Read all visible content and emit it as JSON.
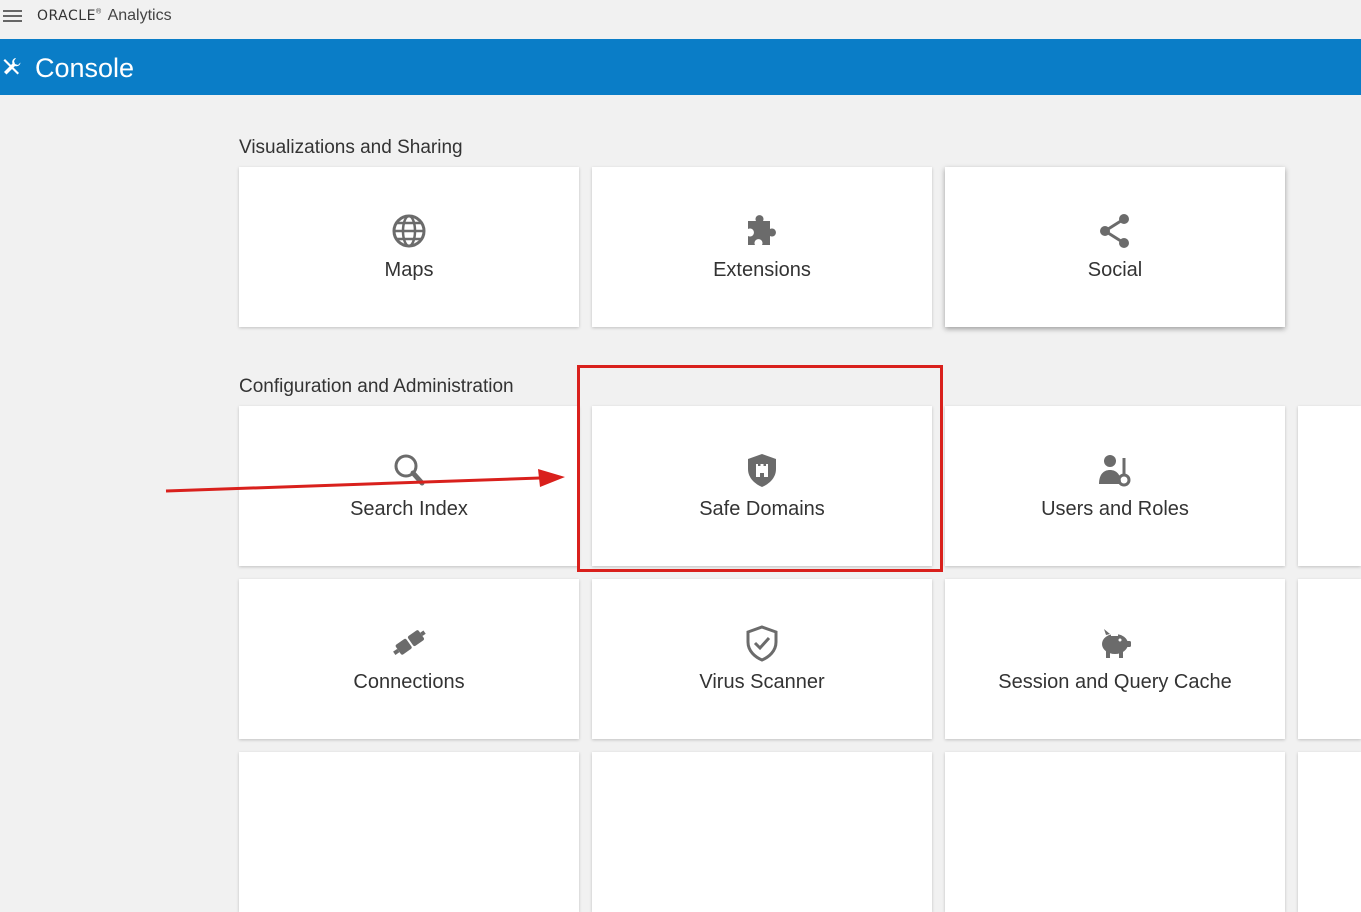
{
  "header": {
    "brand_oracle": "ORACLE",
    "brand_reg": "®",
    "brand_product": "Analytics"
  },
  "console_bar": {
    "title": "Console",
    "background": "#0a7dc7"
  },
  "sections": [
    {
      "title": "Visualizations and Sharing",
      "tiles": [
        {
          "label": "Maps",
          "icon": "globe-icon"
        },
        {
          "label": "Extensions",
          "icon": "puzzle-icon"
        },
        {
          "label": "Social",
          "icon": "share-icon"
        }
      ]
    },
    {
      "title": "Configuration and Administration",
      "tiles": [
        {
          "label": "Search Index",
          "icon": "search-icon"
        },
        {
          "label": "Safe Domains",
          "icon": "castle-shield-icon"
        },
        {
          "label": "Users and Roles",
          "icon": "user-key-icon"
        },
        {
          "label": "Connections",
          "icon": "plug-icon"
        },
        {
          "label": "Virus Scanner",
          "icon": "shield-check-icon"
        },
        {
          "label": "Session and Query Cache",
          "icon": "piggy-bank-icon"
        }
      ]
    }
  ],
  "annotation": {
    "highlight_color": "#d9201c",
    "arrow_color": "#d9201c"
  }
}
